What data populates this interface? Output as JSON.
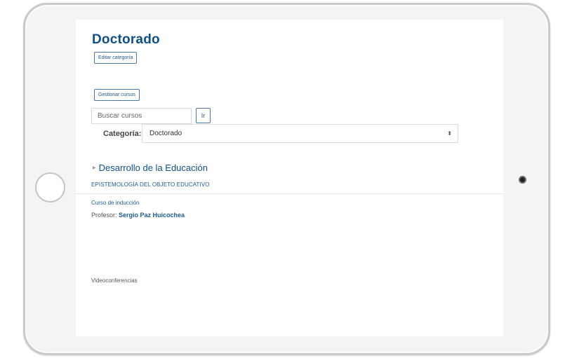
{
  "page": {
    "title": "Doctorado",
    "edit_category_label": "Editar categoría",
    "manage_courses_label": "Gestionar cursos"
  },
  "search": {
    "placeholder": "Buscar cursos",
    "go_label": "Ir"
  },
  "category_filter": {
    "label": "Categoría:",
    "selected": "Doctorado"
  },
  "subcategory": {
    "name": "Desarrollo de la Educación"
  },
  "course": {
    "title": "EPISTEMOLOGÍA DEL OBJETO EDUCATIVO",
    "description": "Curso de inducción",
    "teacher_label": "Profesor:",
    "teacher_name": "Sergio Paz Huicochea"
  },
  "footer": {
    "text": "Videoconferencias"
  },
  "icons": {
    "subcategory_caret": "caret-right-icon",
    "select_arrow": "select-updown-icon"
  },
  "colors": {
    "accent": "#0f4f8a",
    "link": "#1d5c96"
  }
}
